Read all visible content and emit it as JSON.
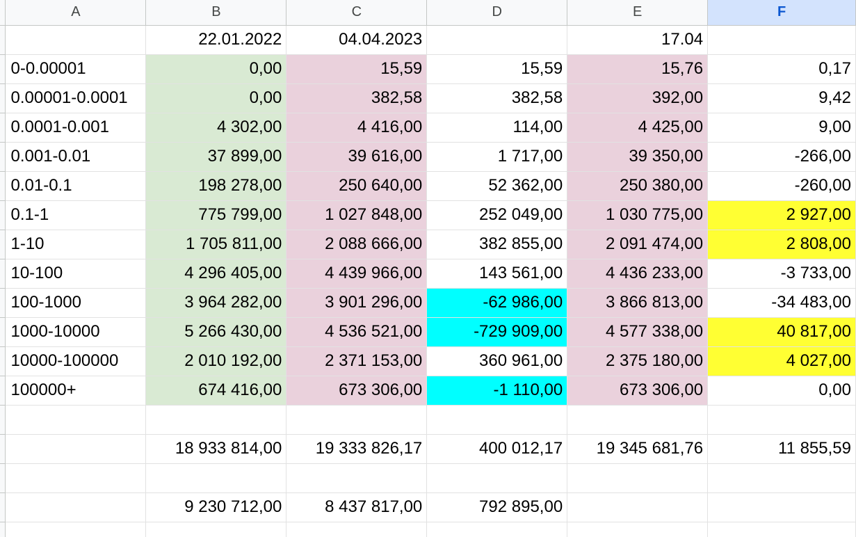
{
  "columns": [
    "A",
    "B",
    "C",
    "D",
    "E",
    "F"
  ],
  "selected_column": "F",
  "colors": {
    "green": "#d9ead3",
    "pink": "#ead1dc",
    "cyan": "#00ffff",
    "yellow": "#ffff33",
    "selected_header": "#d3e3fd"
  },
  "rows": [
    [
      "",
      "22.01.2022",
      "04.04.2023",
      "",
      "17.04",
      ""
    ],
    [
      "0-0.00001",
      "0,00",
      "15,59",
      "15,59",
      "15,76",
      "0,17"
    ],
    [
      "0.00001-0.0001",
      "0,00",
      "382,58",
      "382,58",
      "392,00",
      "9,42"
    ],
    [
      "0.0001-0.001",
      "4 302,00",
      "4 416,00",
      "114,00",
      "4 425,00",
      "9,00"
    ],
    [
      "0.001-0.01",
      "37 899,00",
      "39 616,00",
      "1 717,00",
      "39 350,00",
      "-266,00"
    ],
    [
      "0.01-0.1",
      "198 278,00",
      "250 640,00",
      "52 362,00",
      "250 380,00",
      "-260,00"
    ],
    [
      "0.1-1",
      "775 799,00",
      "1 027 848,00",
      "252 049,00",
      "1 030 775,00",
      "2 927,00"
    ],
    [
      "1-10",
      "1 705 811,00",
      "2 088 666,00",
      "382 855,00",
      "2 091 474,00",
      "2 808,00"
    ],
    [
      "10-100",
      "4 296 405,00",
      "4 439 966,00",
      "143 561,00",
      "4 436 233,00",
      "-3 733,00"
    ],
    [
      "100-1000",
      "3 964 282,00",
      "3 901 296,00",
      "-62 986,00",
      "3 866 813,00",
      "-34 483,00"
    ],
    [
      "1000-10000",
      "5 266 430,00",
      "4 536 521,00",
      "-729 909,00",
      "4 577 338,00",
      "40 817,00"
    ],
    [
      "10000-100000",
      "2 010 192,00",
      "2 371 153,00",
      "360 961,00",
      "2 375 180,00",
      "4 027,00"
    ],
    [
      "100000+",
      "674 416,00",
      "673 306,00",
      "-1 110,00",
      "673 306,00",
      "0,00"
    ],
    [
      "",
      "",
      "",
      "",
      "",
      ""
    ],
    [
      "",
      "18 933 814,00",
      "19 333 826,17",
      "400 012,17",
      "19 345 681,76",
      "11 855,59"
    ],
    [
      "",
      "",
      "",
      "",
      "",
      ""
    ],
    [
      "",
      "9 230 712,00",
      "8 437 817,00",
      "792 895,00",
      "",
      ""
    ],
    [
      "",
      "",
      "",
      "",
      "",
      ""
    ]
  ],
  "fills": [
    [
      "",
      "",
      "",
      "",
      "",
      ""
    ],
    [
      "",
      "green",
      "pink",
      "",
      "pink",
      ""
    ],
    [
      "",
      "green",
      "pink",
      "",
      "pink",
      ""
    ],
    [
      "",
      "green",
      "pink",
      "",
      "pink",
      ""
    ],
    [
      "",
      "green",
      "pink",
      "",
      "pink",
      ""
    ],
    [
      "",
      "green",
      "pink",
      "",
      "pink",
      ""
    ],
    [
      "",
      "green",
      "pink",
      "",
      "pink",
      "yellow"
    ],
    [
      "",
      "green",
      "pink",
      "",
      "pink",
      "yellow"
    ],
    [
      "",
      "green",
      "pink",
      "",
      "pink",
      ""
    ],
    [
      "",
      "green",
      "pink",
      "cyan",
      "pink",
      ""
    ],
    [
      "",
      "green",
      "pink",
      "cyan",
      "pink",
      "yellow"
    ],
    [
      "",
      "green",
      "pink",
      "",
      "pink",
      "yellow"
    ],
    [
      "",
      "green",
      "pink",
      "cyan",
      "pink",
      ""
    ],
    [
      "",
      "",
      "",
      "",
      "",
      ""
    ],
    [
      "",
      "",
      "",
      "",
      "",
      ""
    ],
    [
      "",
      "",
      "",
      "",
      "",
      ""
    ],
    [
      "",
      "",
      "",
      "",
      "",
      ""
    ],
    [
      "",
      "",
      "",
      "",
      "",
      ""
    ]
  ]
}
